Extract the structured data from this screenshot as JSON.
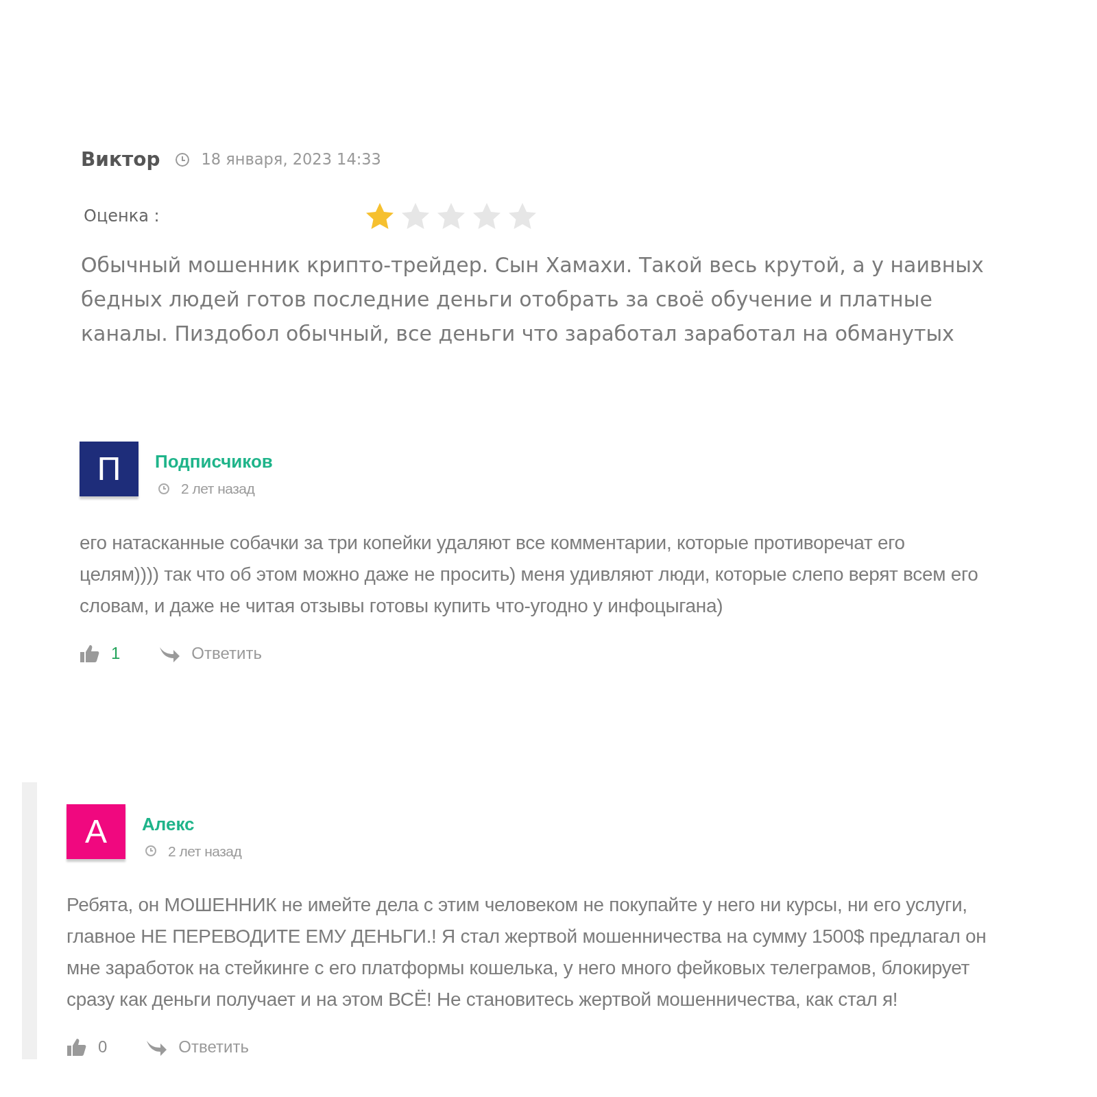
{
  "review": {
    "author": "Виктор",
    "date": "18 января, 2023 14:33",
    "rating_label": "Оценка :",
    "stars": 1,
    "text_lines": [
      "Обычный мошенник крипто-трейдер. Сын Хамахи. Такой весь крутой, а у наивных",
      "бедных людей готов последние деньги отобрать за своё обучение и платные",
      "каналы. Пиздобол обычный, все деньги что заработал заработал на обманутых"
    ]
  },
  "comments": [
    {
      "avatar_letter": "П",
      "color": "#1e2d7a",
      "author": "Подписчиков",
      "time": "2 лет назад",
      "side_bar": false,
      "text_lines": [
        "его натасканные собачки за три копейки удаляют все комментарии, которые противоречат его",
        "целям)))) так что об этом можно даже не просить) меня удивляют люди, которые слепо верят всем его",
        "словам, и даже не читая отзывы готовы купить что-угодно у инфоцыгана)"
      ],
      "likes": "1",
      "liked": true,
      "reply": "Ответить"
    },
    {
      "avatar_letter": "А",
      "color": "#f0087f",
      "author": "Алекс",
      "time": "2 лет назад",
      "side_bar": true,
      "text_lines": [
        "Ребята, он МОШЕННИК не имейте дела с этим человеком не покупайте у него ни курсы, ни его услуги,",
        "главное НЕ ПЕРЕВОДИТЕ ЕМУ ДЕНЬГИ.! Я стал жертвой мошенничества на сумму 1500$ предлагал он",
        "мне заработок на стейкинге с его платформы кошелька, у него много фейковых телеграмов, блокирует",
        "сразу как деньги получает и на этом ВСЁ! Не становитесь жертвой мошенничества, как стал я!"
      ],
      "likes": "0",
      "liked": false,
      "reply": "Ответить"
    }
  ]
}
